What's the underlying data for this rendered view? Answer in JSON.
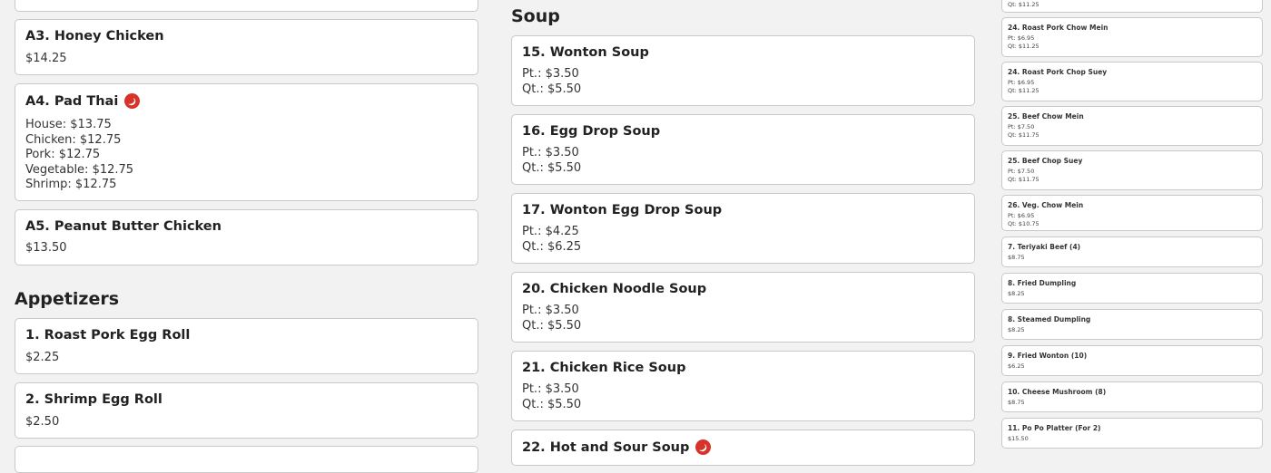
{
  "col1": {
    "items": [
      {
        "title": "A3. Honey Chicken",
        "prices": [
          "$14.25"
        ]
      },
      {
        "title": "A4. Pad Thai",
        "prices": [
          "House: $13.75",
          "Chicken: $12.75",
          "Pork: $12.75",
          "Vegetable: $12.75",
          "Shrimp: $12.75"
        ],
        "hot": true
      },
      {
        "title": "A5. Peanut Butter Chicken",
        "prices": [
          "$13.50"
        ]
      }
    ],
    "section_title": "Appetizers",
    "appetizers": [
      {
        "title": "1. Roast Pork Egg Roll",
        "prices": [
          "$2.25"
        ]
      },
      {
        "title": "2. Shrimp Egg Roll",
        "prices": [
          "$2.50"
        ]
      }
    ]
  },
  "col2": {
    "section_title": "Soup",
    "items": [
      {
        "title": "15. Wonton Soup",
        "prices": [
          "Pt.: $3.50",
          "Qt.: $5.50"
        ]
      },
      {
        "title": "16. Egg Drop Soup",
        "prices": [
          "Pt.: $3.50",
          "Qt.: $5.50"
        ]
      },
      {
        "title": "17. Wonton Egg Drop Soup",
        "prices": [
          "Pt.: $4.25",
          "Qt.: $6.25"
        ]
      },
      {
        "title": "20. Chicken Noodle Soup",
        "prices": [
          "Pt.: $3.50",
          "Qt.: $5.50"
        ]
      },
      {
        "title": "21. Chicken Rice Soup",
        "prices": [
          "Pt.: $3.50",
          "Qt.: $5.50"
        ]
      },
      {
        "title": "22. Hot and Sour Soup",
        "prices": [],
        "hot": true
      }
    ]
  },
  "col3": {
    "top_text": "Qt: $11.25",
    "items": [
      {
        "title": "24. Roast Pork Chow Mein",
        "prices": [
          "Pt: $6.95",
          "Qt: $11.25"
        ]
      },
      {
        "title": "24. Roast Pork Chop Suey",
        "prices": [
          "Pt: $6.95",
          "Qt: $11.25"
        ]
      },
      {
        "title": "25. Beef Chow Mein",
        "prices": [
          "Pt: $7.50",
          "Qt: $11.75"
        ]
      },
      {
        "title": "25. Beef Chop Suey",
        "prices": [
          "Pt: $7.50",
          "Qt: $11.75"
        ]
      },
      {
        "title": "26. Veg. Chow Mein",
        "prices": [
          "Pt: $6.95",
          "Qt: $10.75"
        ]
      },
      {
        "title": "7. Teriyaki Beef (4)",
        "prices": [
          "$8.75"
        ]
      },
      {
        "title": "8. Fried Dumpling",
        "prices": [
          "$8.25"
        ]
      },
      {
        "title": "8. Steamed Dumpling",
        "prices": [
          "$8.25"
        ]
      },
      {
        "title": "9. Fried Wonton (10)",
        "prices": [
          "$6.25"
        ]
      },
      {
        "title": "10. Cheese Mushroom (8)",
        "prices": [
          "$8.75"
        ]
      },
      {
        "title": "11. Po Po Platter (For 2)",
        "prices": [
          "$15.50"
        ]
      }
    ]
  },
  "colors": {
    "hot_icon": "#d7332a",
    "card_border": "#c9c9c9",
    "background": "#f2f2f2"
  }
}
